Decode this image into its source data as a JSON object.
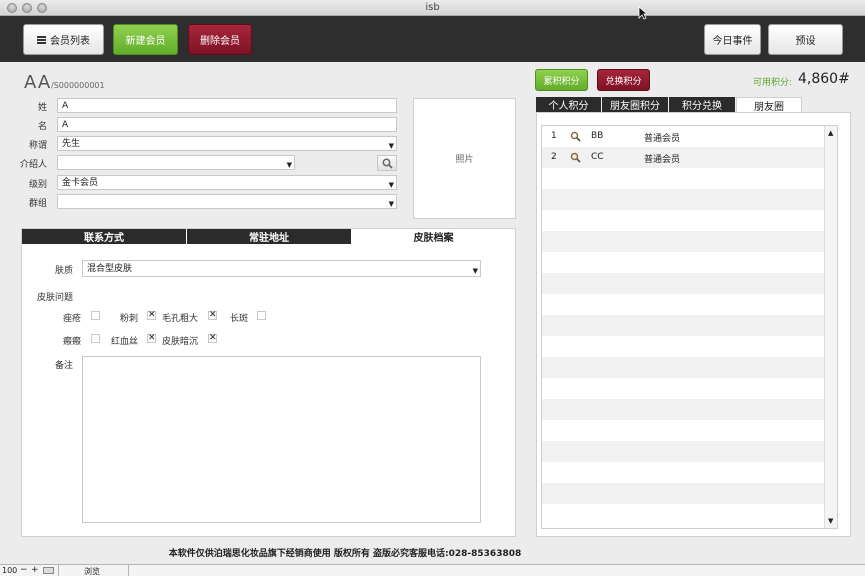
{
  "window": {
    "title": "isb"
  },
  "toolbar": {
    "member_list": "会员列表",
    "new_member": "新建会员",
    "delete_member": "删除会员",
    "today_events": "今日事件",
    "presets": "预设"
  },
  "member": {
    "name": "AA",
    "id": "/S000000001"
  },
  "form": {
    "last_name": {
      "label": "姓",
      "value": "A"
    },
    "first_name": {
      "label": "名",
      "value": "A"
    },
    "title": {
      "label": "称谓",
      "value": "先生"
    },
    "referrer": {
      "label": "介绍人",
      "value": ""
    },
    "level": {
      "label": "级别",
      "value": "金卡会员"
    },
    "group": {
      "label": "群组",
      "value": ""
    },
    "photo": "照片"
  },
  "left_tabs": [
    "联系方式",
    "常驻地址",
    "皮肤档案"
  ],
  "skin": {
    "type_label": "肤质",
    "type_value": "混合型皮肤",
    "issues_label": "皮肤问题",
    "issues": [
      {
        "label": "痤疮",
        "checked": false
      },
      {
        "label": "粉刺",
        "checked": true
      },
      {
        "label": "毛孔粗大",
        "checked": true
      },
      {
        "label": "长斑",
        "checked": false
      },
      {
        "label": "瘢瘢",
        "checked": false
      },
      {
        "label": "红血丝",
        "checked": true
      },
      {
        "label": "皮肤暗沉",
        "checked": true
      }
    ],
    "notes_label": "备注",
    "notes_value": ""
  },
  "points": {
    "accumulate": "累积积分",
    "redeem": "兑换积分",
    "available_label": "可用积分:",
    "available_value": "4,860#"
  },
  "right_tabs": [
    "个人积分",
    "朋友圈积分",
    "积分兑换",
    "朋友圈"
  ],
  "friends": [
    {
      "index": "1",
      "name": "BB",
      "level": "普通会员"
    },
    {
      "index": "2",
      "name": "CC",
      "level": "普通会员"
    }
  ],
  "footer": {
    "notice": "本软件仅供泊瑞思化妆品旗下经销商使用 版权所有 盗版必究客服电话:028-85363808"
  },
  "status": {
    "zoom": "100",
    "mode": "浏览"
  },
  "colors": {
    "green": "#6ab832",
    "red": "#8b1a30",
    "toolbar": "#2e2e2e",
    "accent_text": "#5aa52a"
  }
}
